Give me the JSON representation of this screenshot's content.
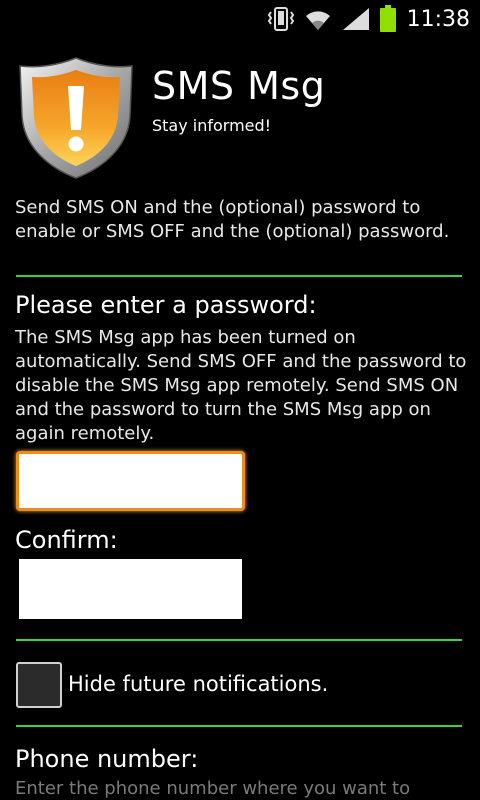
{
  "status_bar": {
    "time": "11:38",
    "icons": [
      "vibrate-icon",
      "wifi-icon",
      "signal-icon",
      "battery-icon"
    ],
    "battery_color": "#8fe000"
  },
  "header": {
    "title": "SMS Msg",
    "subtitle": "Stay informed!",
    "logo_icon": "warning-shield-icon",
    "logo_color": "#f5a31a"
  },
  "intro_text": "Send SMS ON and the (optional) password to enable or SMS OFF and the (optional) password.",
  "password_section": {
    "heading": "Please enter a password:",
    "description": "The SMS Msg app has been turned on automatically. Send SMS OFF and the password to disable the SMS Msg app remotely. Send SMS ON and the password to turn the SMS Msg app on again remotely.",
    "password_value": "",
    "confirm_label": "Confirm:",
    "confirm_value": ""
  },
  "notifications": {
    "label": "Hide future notifications.",
    "checked": false
  },
  "phone_section": {
    "heading": "Phone number:",
    "description": "Enter the phone number where you want to"
  },
  "colors": {
    "divider": "#3bd23b",
    "focus": "#f08c1a"
  }
}
